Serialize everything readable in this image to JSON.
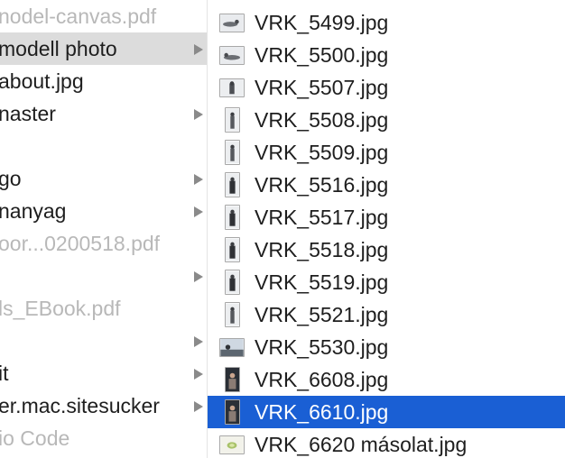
{
  "left_column": {
    "items": [
      {
        "label": "nodel-canvas.pdf",
        "type": "file",
        "dimmed": true,
        "has_chevron": false,
        "selected": false
      },
      {
        "label": "modell photo",
        "type": "folder",
        "dimmed": false,
        "has_chevron": true,
        "selected": true
      },
      {
        "label": "about.jpg",
        "type": "file",
        "dimmed": false,
        "has_chevron": false,
        "selected": false
      },
      {
        "label": "naster",
        "type": "folder",
        "dimmed": false,
        "has_chevron": true,
        "selected": false
      },
      {
        "label": "",
        "type": "file",
        "dimmed": false,
        "has_chevron": false,
        "selected": false
      },
      {
        "label": "go",
        "type": "folder",
        "dimmed": false,
        "has_chevron": true,
        "selected": false
      },
      {
        "label": "nanyag",
        "type": "folder",
        "dimmed": false,
        "has_chevron": true,
        "selected": false
      },
      {
        "label": "oor...0200518.pdf",
        "type": "file",
        "dimmed": true,
        "has_chevron": false,
        "selected": false
      },
      {
        "label": "",
        "type": "folder",
        "dimmed": false,
        "has_chevron": true,
        "selected": false
      },
      {
        "label": "ls_EBook.pdf",
        "type": "file",
        "dimmed": true,
        "has_chevron": false,
        "selected": false
      },
      {
        "label": "",
        "type": "folder",
        "dimmed": false,
        "has_chevron": true,
        "selected": false
      },
      {
        "label": "it",
        "type": "folder",
        "dimmed": false,
        "has_chevron": true,
        "selected": false
      },
      {
        "label": "er.mac.sitesucker",
        "type": "folder",
        "dimmed": false,
        "has_chevron": true,
        "selected": false
      },
      {
        "label": "io Code",
        "type": "file",
        "dimmed": true,
        "has_chevron": false,
        "selected": false
      }
    ]
  },
  "right_column": {
    "files": [
      {
        "name": "VRK_5499.jpg",
        "thumb": "landscape",
        "selected": false
      },
      {
        "name": "VRK_5500.jpg",
        "thumb": "landscape",
        "selected": false
      },
      {
        "name": "VRK_5507.jpg",
        "thumb": "landscape",
        "selected": false
      },
      {
        "name": "VRK_5508.jpg",
        "thumb": "portrait",
        "selected": false
      },
      {
        "name": "VRK_5509.jpg",
        "thumb": "portrait",
        "selected": false
      },
      {
        "name": "VRK_5516.jpg",
        "thumb": "portrait",
        "selected": false
      },
      {
        "name": "VRK_5517.jpg",
        "thumb": "portrait",
        "selected": false
      },
      {
        "name": "VRK_5518.jpg",
        "thumb": "portrait",
        "selected": false
      },
      {
        "name": "VRK_5519.jpg",
        "thumb": "portrait",
        "selected": false
      },
      {
        "name": "VRK_5521.jpg",
        "thumb": "portrait",
        "selected": false
      },
      {
        "name": "VRK_5530.jpg",
        "thumb": "landscape",
        "selected": false
      },
      {
        "name": "VRK_6608.jpg",
        "thumb": "portrait-dark",
        "selected": false
      },
      {
        "name": "VRK_6610.jpg",
        "thumb": "portrait-dark",
        "selected": true
      },
      {
        "name": "VRK_6620 másolat.jpg",
        "thumb": "landscape",
        "selected": false
      }
    ]
  },
  "colors": {
    "selection_blue": "#1a5fd4",
    "folder_selected_gray": "#dcdcdc",
    "text": "#1e1e1e",
    "dimmed_text": "#b8b8b8",
    "chevron": "#8a8a8a"
  },
  "icons": {
    "chevron": "chevron-right-icon",
    "thumbnail": "image-thumbnail-icon"
  }
}
